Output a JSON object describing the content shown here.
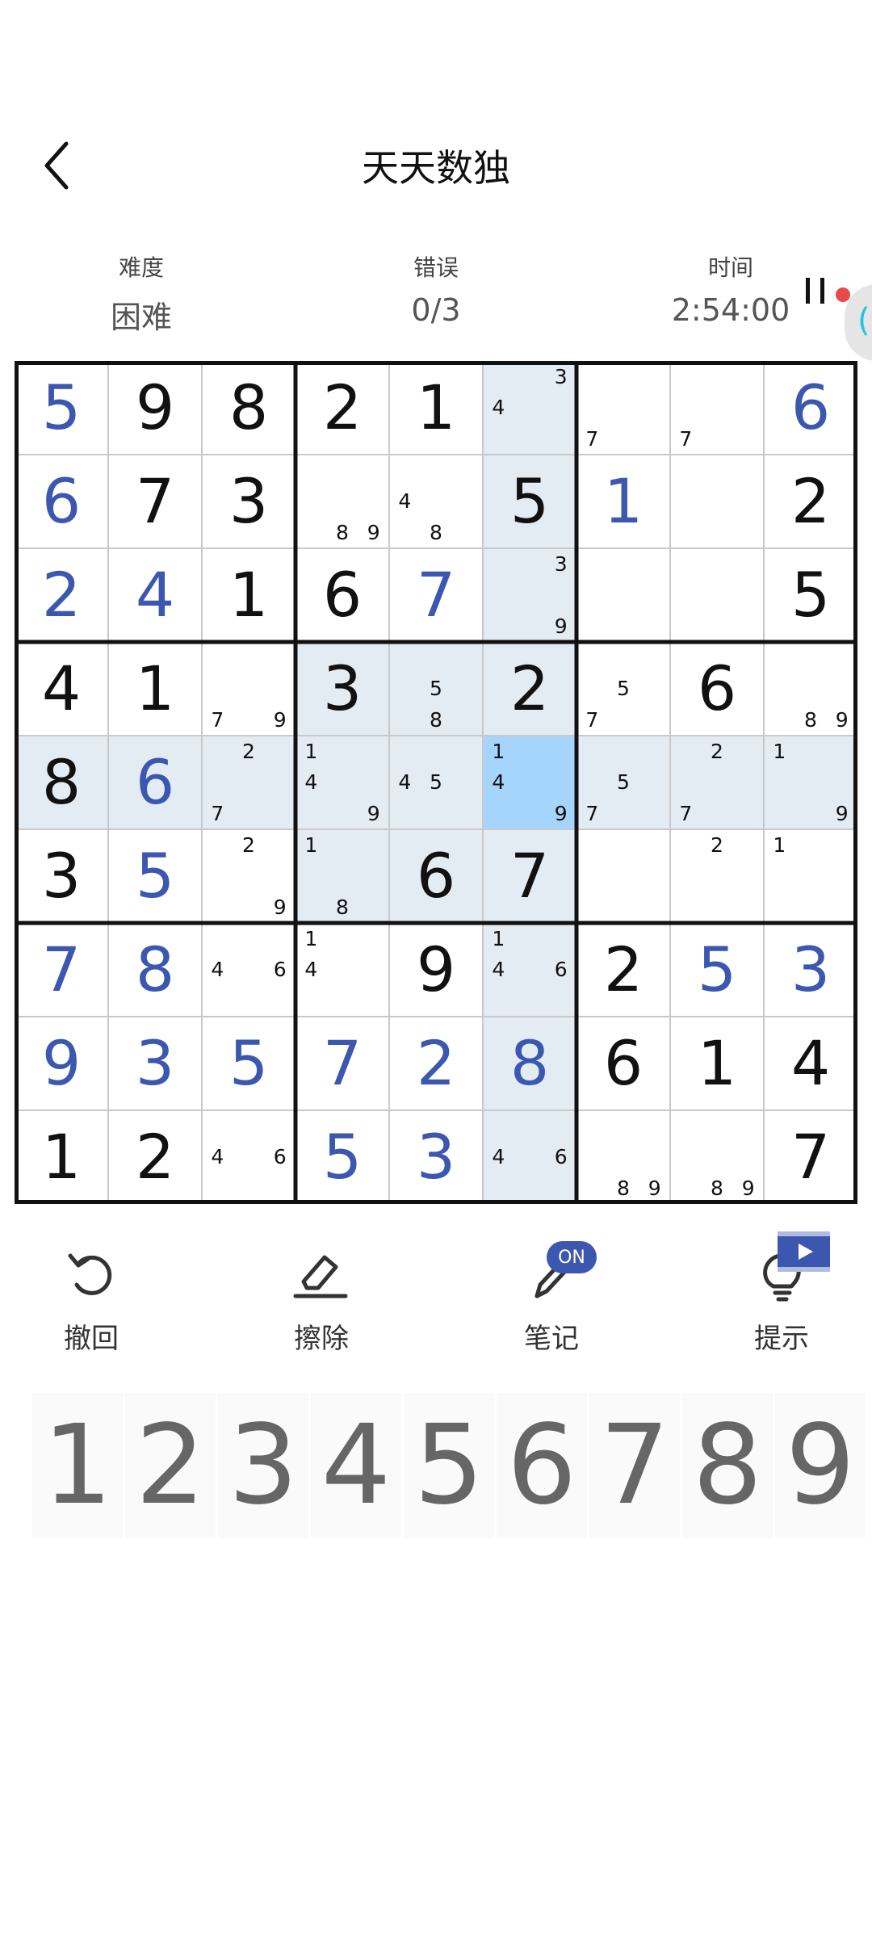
{
  "header": {
    "title": "天天数独"
  },
  "stats": [
    {
      "label": "难度",
      "value": "困难"
    },
    {
      "label": "错误",
      "value": "0/3"
    },
    {
      "label": "时间",
      "value": "2:54:00"
    }
  ],
  "colors": {
    "given": "#111111",
    "entered": "#3b57b0",
    "highlight": "#e3ebf3",
    "selected": "#a6d5fb",
    "accent": "#3b57b0"
  },
  "selected_cell": [
    4,
    5
  ],
  "board": [
    [
      "u:5",
      "g:9",
      "g:8",
      "g:2",
      "g:1",
      "n:34",
      "n:7",
      "n:7",
      "u:6"
    ],
    [
      "u:6",
      "g:7",
      "g:3",
      "n:89",
      "n:48",
      "g:5",
      "u:1",
      "",
      "g:2"
    ],
    [
      "u:2",
      "u:4",
      "g:1",
      "g:6",
      "u:7",
      "n:39",
      "",
      "",
      "g:5"
    ],
    [
      "g:4",
      "g:1",
      "n:79",
      "g:3",
      "n:58",
      "g:2",
      "n:57",
      "g:6",
      "n:89"
    ],
    [
      "g:8",
      "u:6",
      "n:27",
      "n:149",
      "n:45",
      "n:149",
      "n:57",
      "n:27",
      "n:19"
    ],
    [
      "g:3",
      "u:5",
      "n:29",
      "n:18",
      "g:6",
      "g:7",
      "",
      "n:2",
      "n:1"
    ],
    [
      "u:7",
      "u:8",
      "n:46",
      "n:14",
      "g:9",
      "n:146",
      "g:2",
      "u:5",
      "u:3"
    ],
    [
      "u:9",
      "u:3",
      "u:5",
      "u:7",
      "u:2",
      "u:8",
      "g:6",
      "g:1",
      "g:4"
    ],
    [
      "g:1",
      "g:2",
      "n:46",
      "u:5",
      "u:3",
      "n:46",
      "n:89",
      "n:89",
      "g:7"
    ]
  ],
  "toolbar": [
    {
      "label": "撤回",
      "icon": "undo-icon"
    },
    {
      "label": "擦除",
      "icon": "eraser-icon"
    },
    {
      "label": "笔记",
      "icon": "pencil-icon"
    },
    {
      "label": "提示",
      "icon": "lightbulb-icon"
    }
  ],
  "notes_badge": "ON",
  "numpad": [
    "1",
    "2",
    "3",
    "4",
    "5",
    "6",
    "7",
    "8",
    "9"
  ]
}
